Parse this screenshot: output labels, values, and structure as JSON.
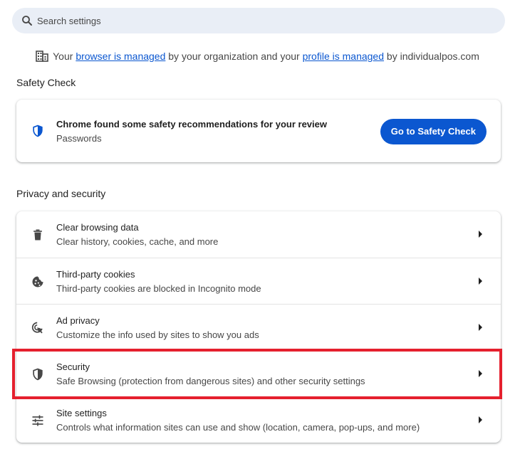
{
  "search": {
    "placeholder": "Search settings",
    "icon": "search-icon"
  },
  "managed": {
    "prefix": "Your ",
    "browser_link": "browser is managed",
    "middle": " by your organization and your ",
    "profile_link": "profile is managed",
    "suffix": " by individualpos.com",
    "icon": "building-icon"
  },
  "safety_check": {
    "section_title": "Safety Check",
    "title": "Chrome found some safety recommendations for your review",
    "subtitle": "Passwords",
    "button_label": "Go to Safety Check",
    "icon": "shield-check-icon"
  },
  "privacy": {
    "section_title": "Privacy and security",
    "items": [
      {
        "title": "Clear browsing data",
        "subtitle": "Clear history, cookies, cache, and more",
        "icon": "trash-icon"
      },
      {
        "title": "Third-party cookies",
        "subtitle": "Third-party cookies are blocked in Incognito mode",
        "icon": "cookie-icon"
      },
      {
        "title": "Ad privacy",
        "subtitle": "Customize the info used by sites to show you ads",
        "icon": "ad-privacy-icon"
      },
      {
        "title": "Security",
        "subtitle": "Safe Browsing (protection from dangerous sites) and other security settings",
        "icon": "shield-icon"
      },
      {
        "title": "Site settings",
        "subtitle": "Controls what information sites can use and show (location, camera, pop-ups, and more)",
        "icon": "tune-icon"
      }
    ]
  },
  "colors": {
    "accent": "#0b57d0",
    "highlight": "#e5202e",
    "search_bg": "#e9eef6"
  }
}
